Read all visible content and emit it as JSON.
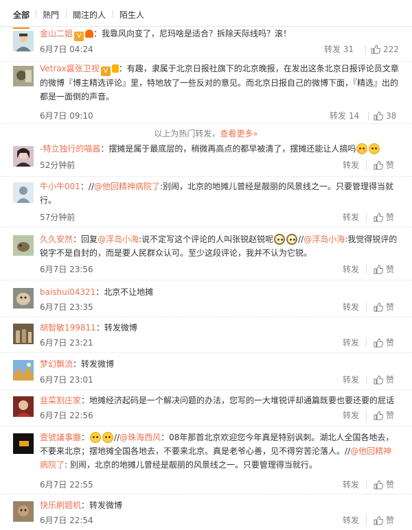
{
  "tabs": [
    "全部",
    "熱門",
    "關注的人",
    "陌生人"
  ],
  "hot_divider": {
    "prefix": "以上为热门转发，",
    "link": "查看更多»"
  },
  "labels": {
    "forward": "转发",
    "like": "赞"
  },
  "comments": [
    {
      "user": "金山二姐",
      "segments": [
        {
          "t": "：我靠风向变了，尼玛啥是适合？拆除天际线吗？滚！"
        }
      ],
      "time": "6月7日 04:24",
      "forward_label": "转发 31",
      "like_label": "222"
    },
    {
      "user": "Vetrax醤张卫视",
      "segments": [
        {
          "t": "：有趣，隶属于北京日报社旗下的北京晚报，在发出这条北京日报评论员文章的微博『博主精选评论』里，特地放了一些反对的意见。而北京日报自己的微博下面，『精选』出的都是一面倒的声音。"
        }
      ],
      "time": "6月7日 09:10",
      "forward_label": "转发 14",
      "like_label": "38"
    },
    {
      "user": "-特立独行的喵酱",
      "segments": [
        {
          "t": "：摆摊是属于最底层的，稍微再高点的都早被清了，摆摊还能让人搞吗"
        }
      ],
      "time": "52分钟前",
      "forward_label": "转发",
      "like_label": "赞"
    },
    {
      "user": "牛小牛001",
      "segments": [
        {
          "t": "：//"
        },
        {
          "link": "@他回精神病院了"
        },
        {
          "t": ":别闹，北京的地摊儿曾经是靓丽的风景线之一。只要管理得当就行。"
        }
      ],
      "time": "57分钟前",
      "forward_label": "转发",
      "like_label": "赞"
    },
    {
      "user": "久久安然",
      "segments": [
        {
          "t": "：回复"
        },
        {
          "link": "@浮岛小海"
        },
        {
          "t": ":说不定写这个评论的人叫张锐赵锐呢"
        },
        {
          "t": "//"
        },
        {
          "link": "@浮岛小海"
        },
        {
          "t": ":我觉得锐评的锐字不是自封的，而是要人民群众认可。至少这段评论，我并不认为它锐。"
        }
      ],
      "time": "6月7日 23:56",
      "forward_label": "转发",
      "like_label": "赞"
    },
    {
      "user": "baishui04321",
      "segments": [
        {
          "t": "：北京不让地摊"
        }
      ],
      "time": "6月7日 23:35",
      "forward_label": "转发",
      "like_label": "赞"
    },
    {
      "user": "胡智敏199811",
      "segments": [
        {
          "t": "：转发微博"
        }
      ],
      "time": "6月7日 23:21",
      "forward_label": "转发",
      "like_label": "赞"
    },
    {
      "user": "梦幻飘流",
      "segments": [
        {
          "t": "：转发微博"
        }
      ],
      "time": "6月7日 23:01",
      "forward_label": "转发",
      "like_label": "赞"
    },
    {
      "user": "韭菜割庄家",
      "segments": [
        {
          "t": "：地摊经济起码是一个解决问题的办法，您写的一大堆锐评却通篇既要也要还要的屁话"
        }
      ],
      "time": "6月7日 22:56",
      "forward_label": "转发",
      "like_label": "赞"
    },
    {
      "user": "壹號議事廳",
      "segments": [
        {
          "t": "："
        },
        {
          "t": "//"
        },
        {
          "link": "@珠海西风"
        },
        {
          "t": "：08年那首北京欢迎您今年真是特别讽刺。湖北人全国各地去，不要来北京；摆地摊全国各地去，不要来北京。真是老爷心善，见不得穷苦沦落人。//"
        },
        {
          "link": "@他回精神病院了"
        },
        {
          "t": ": 别闹，北京的地摊儿曾经是靓丽的风景线之一。只要管理得当就行。"
        }
      ],
      "time": "6月7日 22:55",
      "forward_label": "转发",
      "like_label": "赞"
    },
    {
      "user": "快乐刷题机",
      "segments": [
        {
          "t": "：转发微博"
        }
      ],
      "time": "6月7日 22:54",
      "forward_label": "转发",
      "like_label": "赞"
    }
  ]
}
